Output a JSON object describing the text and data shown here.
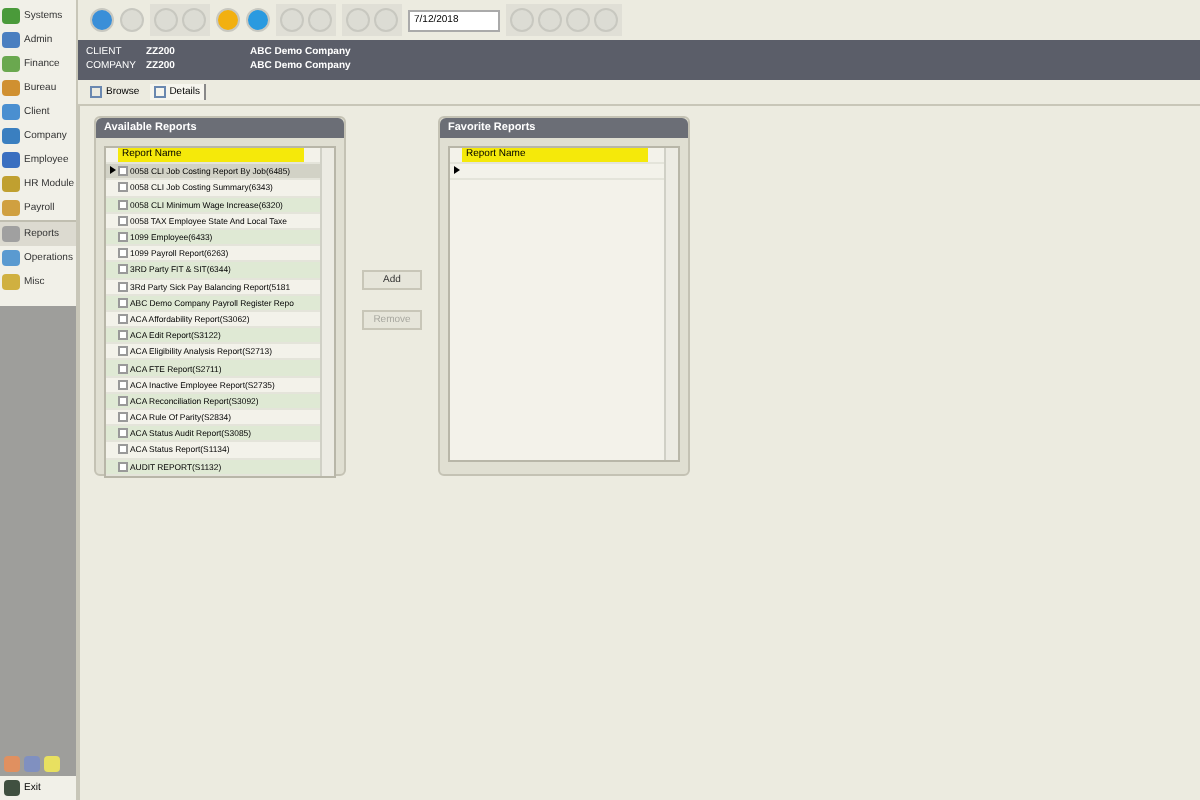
{
  "sidebar": {
    "items": [
      {
        "label": "Systems",
        "selected": false,
        "color": "#4a9a3a"
      },
      {
        "label": "Admin",
        "selected": false,
        "color": "#4a7fc0"
      },
      {
        "label": "Finance",
        "selected": false,
        "color": "#6aa84f"
      },
      {
        "label": "Bureau",
        "selected": false,
        "color": "#d09030"
      },
      {
        "label": "Client",
        "selected": false,
        "color": "#4a8fd0"
      },
      {
        "label": "Company",
        "selected": false,
        "color": "#3a7fc0"
      },
      {
        "label": "Employee",
        "selected": false,
        "color": "#3a6fc0"
      },
      {
        "label": "HR Module",
        "selected": false,
        "color": "#c0a030"
      },
      {
        "label": "Payroll",
        "selected": false,
        "color": "#d0a040"
      },
      {
        "label": "Reports",
        "selected": true,
        "color": "#a0a0a0"
      },
      {
        "label": "Operations",
        "selected": false,
        "color": "#5a9ad0"
      },
      {
        "label": "Misc",
        "selected": false,
        "color": "#d0b040"
      }
    ],
    "exit": "Exit"
  },
  "toolbar": {
    "date": "7/12/2018"
  },
  "header": {
    "rows": [
      {
        "label": "CLIENT",
        "code": "ZZ200",
        "name": "ABC Demo Company"
      },
      {
        "label": "COMPANY",
        "code": "ZZ200",
        "name": "ABC Demo Company"
      }
    ]
  },
  "tabs": [
    {
      "label": "Browse",
      "selected": false
    },
    {
      "label": "Details",
      "selected": true
    }
  ],
  "available": {
    "title": "Available Reports",
    "column": "Report Name",
    "rows": [
      {
        "name": "0058 CLI Job Costing Report By Job(6485)",
        "selected": true,
        "checked": false
      },
      {
        "name": "0058 CLI Job Costing Summary(6343)",
        "selected": false,
        "checked": false
      },
      {
        "name": "0058 CLI Minimum Wage Increase(6320)",
        "selected": false,
        "checked": false
      },
      {
        "name": "0058 TAX Employee State And Local Taxe",
        "selected": false,
        "checked": false
      },
      {
        "name": "1099 Employee(6433)",
        "selected": false,
        "checked": false
      },
      {
        "name": "1099 Payroll Report(6263)",
        "selected": false,
        "checked": false
      },
      {
        "name": "3RD Party FIT & SIT(6344)",
        "selected": false,
        "checked": false
      },
      {
        "name": "3Rd Party Sick Pay Balancing Report(5181",
        "selected": false,
        "checked": false
      },
      {
        "name": "ABC Demo Company Payroll Register Repo",
        "selected": false,
        "checked": false
      },
      {
        "name": "ACA Affordability Report(S3062)",
        "selected": false,
        "checked": false
      },
      {
        "name": "ACA Edit Report(S3122)",
        "selected": false,
        "checked": false
      },
      {
        "name": "ACA Eligibility Analysis Report(S2713)",
        "selected": false,
        "checked": false
      },
      {
        "name": "ACA FTE Report(S2711)",
        "selected": false,
        "checked": false
      },
      {
        "name": "ACA Inactive Employee Report(S2735)",
        "selected": false,
        "checked": false
      },
      {
        "name": "ACA Reconciliation Report(S3092)",
        "selected": false,
        "checked": false
      },
      {
        "name": "ACA Rule Of Parity(S2834)",
        "selected": false,
        "checked": false
      },
      {
        "name": "ACA Status Audit Report(S3085)",
        "selected": false,
        "checked": false
      },
      {
        "name": "ACA Status Report(S1134)",
        "selected": false,
        "checked": false
      },
      {
        "name": "AUDIT REPORT(S1132)",
        "selected": false,
        "checked": false
      }
    ]
  },
  "actions": [
    {
      "label": "Add",
      "disabled": false
    },
    {
      "label": "Remove",
      "disabled": true
    }
  ],
  "favorite": {
    "title": "Favorite Reports",
    "column": "Report Name"
  }
}
